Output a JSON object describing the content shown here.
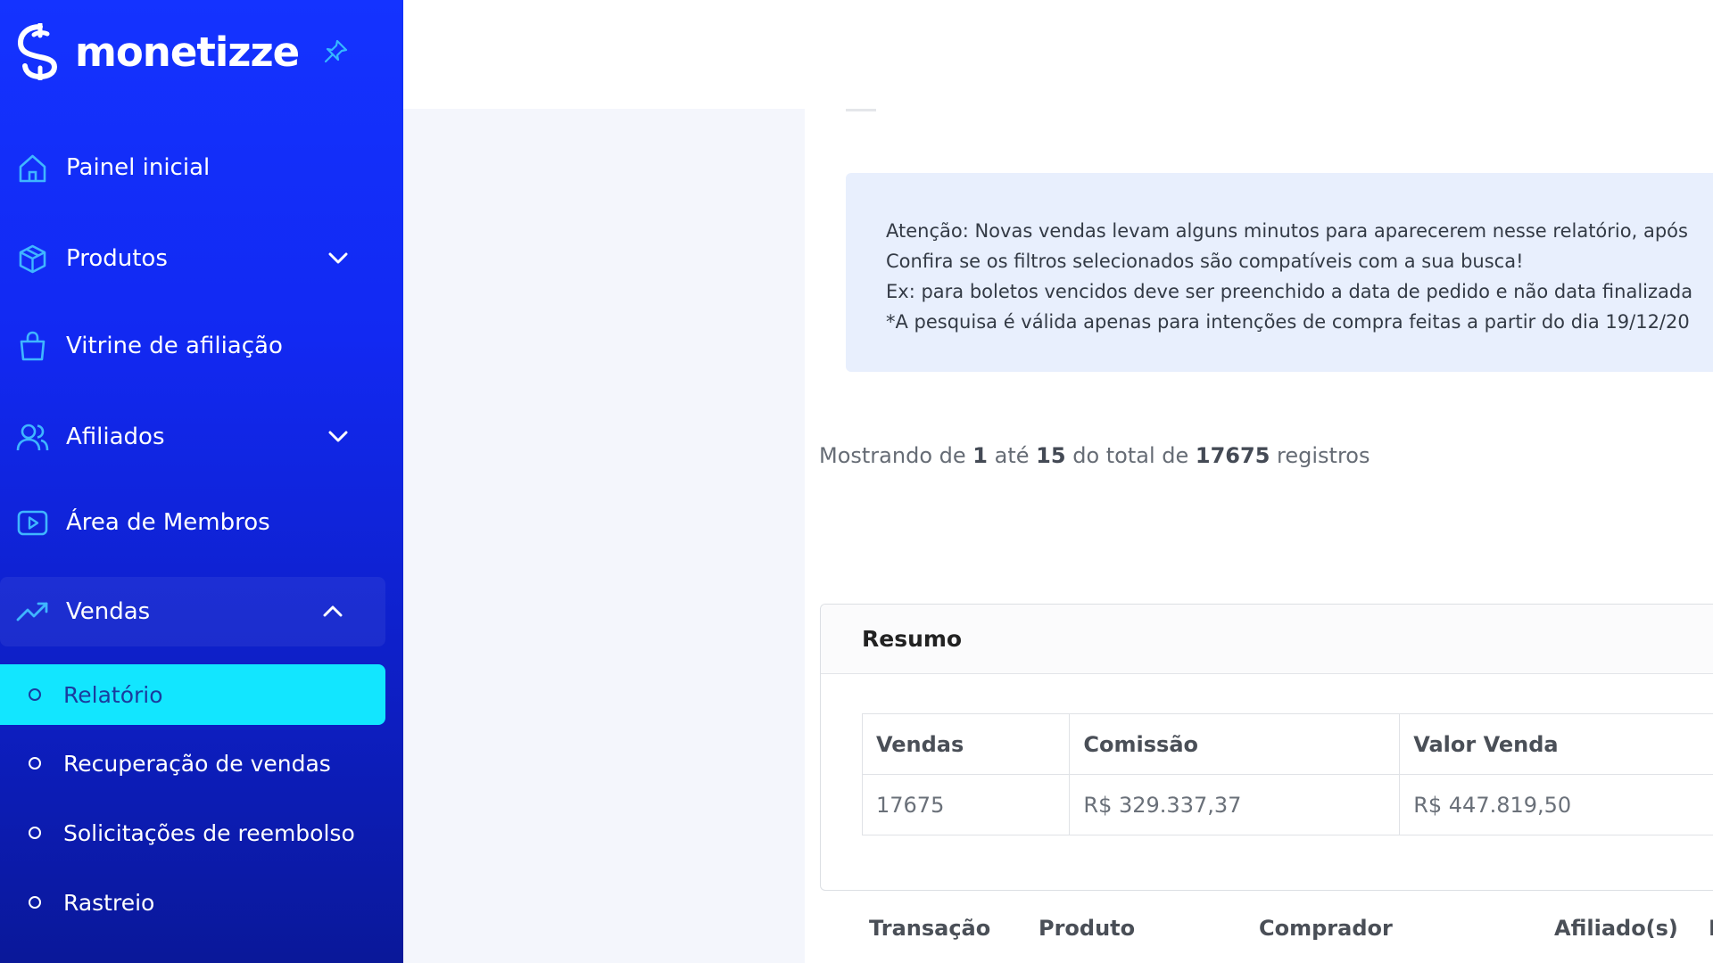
{
  "brand": {
    "name": "monetizze"
  },
  "sidebar": {
    "items": [
      {
        "label": "Painel inicial",
        "icon": "home-icon"
      },
      {
        "label": "Produtos",
        "icon": "box-icon"
      },
      {
        "label": "Vitrine de afiliação",
        "icon": "shopping-bag-icon"
      },
      {
        "label": "Afiliados",
        "icon": "users-icon"
      },
      {
        "label": "Área de Membros",
        "icon": "play-square-icon"
      },
      {
        "label": "Vendas",
        "icon": "trending-up-icon"
      }
    ],
    "sub_items": [
      {
        "label": "Relatório",
        "active": true
      },
      {
        "label": "Recuperação de vendas"
      },
      {
        "label": "Solicitações de reembolso"
      },
      {
        "label": "Rastreio"
      }
    ]
  },
  "alert": {
    "lines": [
      "Atenção: Novas vendas levam alguns minutos para aparecerem nesse relatório, após",
      "Confira se os filtros selecionados são compatíveis com a sua busca!",
      "Ex: para boletos vencidos deve ser preenchido a data de pedido e não data finalizada",
      "*A pesquisa é válida apenas para intenções de compra feitas a partir do dia 19/12/20"
    ]
  },
  "showing": {
    "prefix": "Mostrando de",
    "from": "1",
    "to_word": "até",
    "to": "15",
    "total_word": "do total de",
    "total": "17675",
    "suffix": "registros"
  },
  "summary": {
    "title": "Resumo",
    "headers": [
      "Vendas",
      "Comissão",
      "Valor Venda"
    ],
    "row": [
      "17675",
      "R$ 329.337,37",
      "R$ 447.819,50"
    ]
  },
  "table": {
    "columns": [
      "Transação",
      "Produto",
      "Comprador",
      "Afiliado(s)",
      "I"
    ]
  },
  "colors": {
    "sidebar": "#1433ff",
    "active_item": "#12e6ff",
    "alert_bg": "#e8effd"
  }
}
